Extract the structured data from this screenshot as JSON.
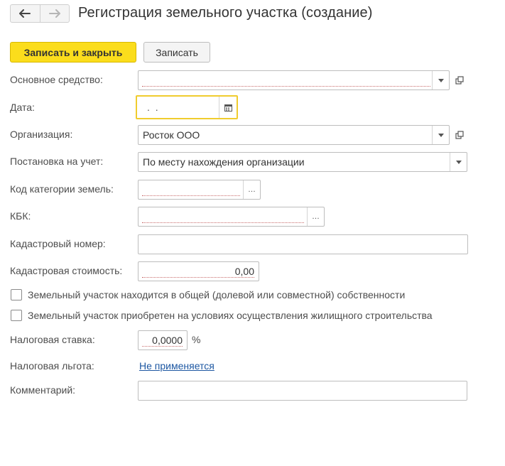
{
  "window": {
    "title": "Регистрация земельного участка (создание)"
  },
  "nav": {
    "back_icon": "arrow-left-icon",
    "forward_icon": "arrow-right-icon"
  },
  "toolbar": {
    "save_close_label": "Записать и закрыть",
    "save_label": "Записать"
  },
  "form": {
    "fixed_asset": {
      "label": "Основное средство:",
      "value": ""
    },
    "date": {
      "label": "Дата:",
      "value": ".  ."
    },
    "organization": {
      "label": "Организация:",
      "value": "Росток ООО"
    },
    "registration": {
      "label": "Постановка на учет:",
      "value": "По месту нахождения организации"
    },
    "land_category_code": {
      "label": "Код категории земель:",
      "value": ""
    },
    "kbk": {
      "label": "КБК:",
      "value": ""
    },
    "cadastral_number": {
      "label": "Кадастровый номер:",
      "value": ""
    },
    "cadastral_value": {
      "label": "Кадастровая стоимость:",
      "value": "0,00"
    },
    "shared_ownership": {
      "label": "Земельный участок находится в общей (долевой или совместной) собственности",
      "checked": false
    },
    "housing_construction": {
      "label": "Земельный участок приобретен на условиях осуществления жилищного строительства",
      "checked": false
    },
    "tax_rate": {
      "label": "Налоговая ставка:",
      "value": "0,0000",
      "unit": "%"
    },
    "tax_benefit": {
      "label": "Налоговая льгота:",
      "value": "Не применяется"
    },
    "comment": {
      "label": "Комментарий:",
      "value": ""
    }
  },
  "colors": {
    "primary_button": "#fbdd1c",
    "focus_border": "#f0cc2e",
    "link": "#1d57a2"
  }
}
